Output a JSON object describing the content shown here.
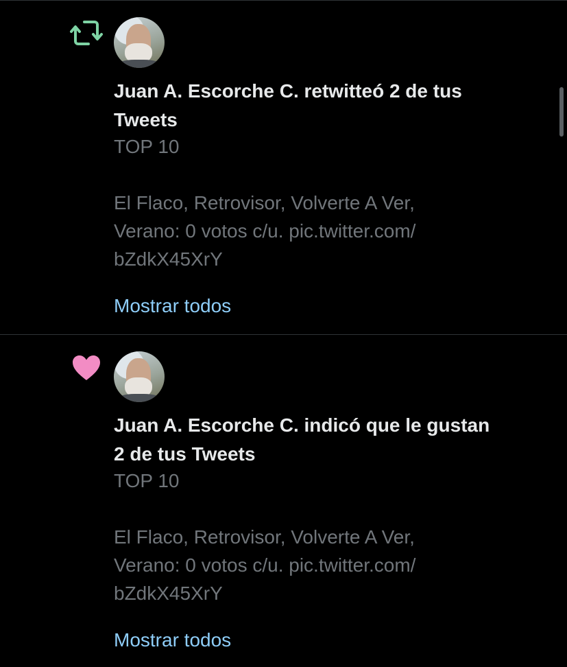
{
  "colors": {
    "background": "#000000",
    "divider": "#2f3336",
    "primary_text": "#e7e9ea",
    "secondary_text": "#71767b",
    "link": "#8ecdf8",
    "retweet_green": "#7ed3a4",
    "like_pink": "#f28cc4"
  },
  "notifications": [
    {
      "icon": "retweet-icon",
      "user_name": "Juan A. Escorche C.",
      "action_line1": " retwitteó 2 de tus",
      "action_line2": "Tweets",
      "tweet_lines": [
        "TOP 10",
        "",
        "El Flaco, Retrovisor, Volverte A Ver,",
        "Verano: 0 votos c/u. pic.twitter.com/",
        "bZdkX45XrY"
      ],
      "show_all_label": "Mostrar todos"
    },
    {
      "icon": "heart-icon",
      "user_name": "Juan A. Escorche C.",
      "action_line1": " indicó que le gustan",
      "action_line2": "2 de tus Tweets",
      "tweet_lines": [
        "TOP 10",
        "",
        "El Flaco, Retrovisor, Volverte A Ver,",
        "Verano: 0 votos c/u. pic.twitter.com/",
        "bZdkX45XrY"
      ],
      "show_all_label": "Mostrar todos"
    }
  ]
}
